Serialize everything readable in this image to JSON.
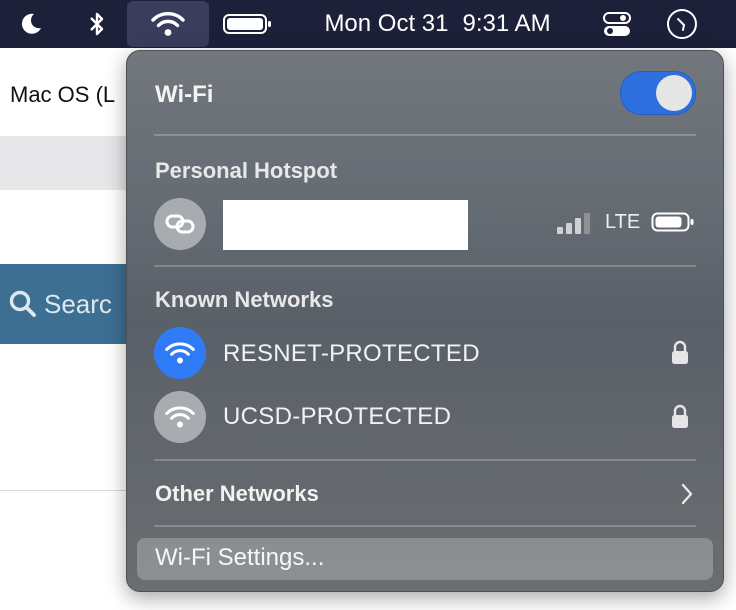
{
  "menubar": {
    "clock_date": "Mon Oct 31",
    "clock_time": "9:31 AM",
    "icons": [
      "moon-icon",
      "bluetooth-icon",
      "wifi-icon",
      "battery-icon",
      "control-center-icon",
      "clock-widget-icon"
    ]
  },
  "app": {
    "title_fragment": "Mac OS (L",
    "search_fragment": "Searc"
  },
  "wifi": {
    "title": "Wi-Fi",
    "enabled": true,
    "personal_hotspot_header": "Personal Hotspot",
    "hotspot_network_type": "LTE",
    "known_networks_header": "Known Networks",
    "known_networks": [
      {
        "name": "RESNET-PROTECTED",
        "connected": true,
        "secured": true
      },
      {
        "name": "UCSD-PROTECTED",
        "connected": false,
        "secured": true
      }
    ],
    "other_networks_label": "Other Networks",
    "settings_label": "Wi-Fi Settings..."
  },
  "colors": {
    "menubar_bg": "#1d2039",
    "toggle_on": "#2e6fe0",
    "connected_blue": "#2f7bf6"
  }
}
